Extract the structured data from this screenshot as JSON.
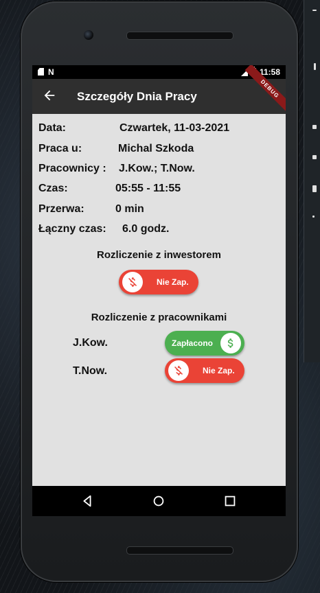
{
  "status_bar": {
    "time": "11:58"
  },
  "app_bar": {
    "title": "Szczegóły Dnia Pracy",
    "debug_label": "DEBUG"
  },
  "details": [
    {
      "label": "Data:",
      "value": "Czwartek, 11-03-2021"
    },
    {
      "label": "Praca u:",
      "value": "Michal Szkoda"
    },
    {
      "label": "Pracownicy :",
      "value": "J.Kow.; T.Now."
    },
    {
      "label": "Czas:",
      "value": "05:55 - 11:55"
    },
    {
      "label": "Przerwa:",
      "value": "0 min"
    },
    {
      "label": "Łączny czas:",
      "value": "6.0 godz."
    }
  ],
  "investor_settlement": {
    "title": "Rozliczenie z inwestorem",
    "status_label": "Nie Zap.",
    "status": "unpaid"
  },
  "workers_settlement": {
    "title": "Rozliczenie z pracownikami",
    "workers": [
      {
        "name": "J.Kow.",
        "status_label": "Zapłacono",
        "status": "paid"
      },
      {
        "name": "T.Now.",
        "status_label": "Nie Zap.",
        "status": "unpaid"
      }
    ]
  },
  "colors": {
    "paid": "#4caf50",
    "unpaid": "#ea4336",
    "app_bar": "#2f2f2f",
    "background": "#e1e1e1"
  },
  "icons": [
    "back-arrow-icon",
    "dollar-off-icon",
    "dollar-icon",
    "nav-back-icon",
    "nav-home-icon",
    "nav-recents-icon"
  ]
}
